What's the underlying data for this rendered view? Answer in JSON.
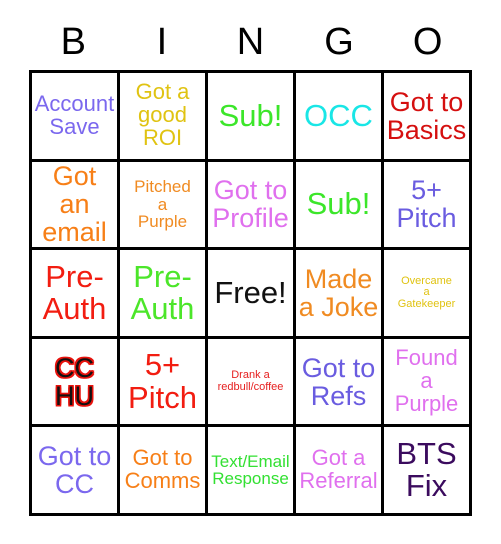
{
  "card": {
    "title": "BINGO",
    "headers": [
      "B",
      "I",
      "N",
      "G",
      "O"
    ],
    "background": "#ffffff",
    "grid_line_color": "#000000",
    "rows": [
      [
        {
          "text": "Account\nSave",
          "color": "#7b68ee",
          "size": "md"
        },
        {
          "text": "Got a\ngood\nROI",
          "color": "#e0c312",
          "size": "md"
        },
        {
          "text": "Sub!",
          "color": "#3ce62a",
          "size": "xl"
        },
        {
          "text": "OCC",
          "color": "#19e6e6",
          "size": "xl"
        },
        {
          "text": "Got to\nBasics",
          "color": "#d50f0f",
          "size": "lg"
        }
      ],
      [
        {
          "text": "Got an\nemail",
          "color": "#f77f17",
          "size": "lg"
        },
        {
          "text": "Pitched\na\nPurple",
          "color": "#f08b22",
          "size": "sm"
        },
        {
          "text": "Got to\nProfile",
          "color": "#e070ee",
          "size": "lg"
        },
        {
          "text": "Sub!",
          "color": "#3ce62a",
          "size": "xl"
        },
        {
          "text": "5+\nPitch",
          "color": "#6a5ce0",
          "size": "lg"
        }
      ],
      [
        {
          "text": "Pre-\nAuth",
          "color": "#f21d11",
          "size": "xl"
        },
        {
          "text": "Pre-\nAuth",
          "color": "#4ce62a",
          "size": "xl"
        },
        {
          "text": "Free!",
          "color": "#111111",
          "size": "xl"
        },
        {
          "text": "Made\na Joke",
          "color": "#f08b22",
          "size": "lg"
        },
        {
          "text": "Overcame\na\nGatekeeper",
          "color": "#e0c312",
          "size": "xs"
        }
      ],
      [
        {
          "text": "CC\nHU",
          "color": "#111111",
          "size": "lg",
          "style": "shadow-red"
        },
        {
          "text": "5+\nPitch",
          "color": "#f21d11",
          "size": "xl"
        },
        {
          "text": "Drank a\nredbull/coffee",
          "color": "#e62020",
          "size": "xs"
        },
        {
          "text": "Got to\nRefs",
          "color": "#6a5ce0",
          "size": "lg"
        },
        {
          "text": "Found\na\nPurple",
          "color": "#e070ee",
          "size": "md"
        }
      ],
      [
        {
          "text": "Got to\nCC",
          "color": "#7b68ee",
          "size": "lg"
        },
        {
          "text": "Got to\nComms",
          "color": "#f77f17",
          "size": "md"
        },
        {
          "text": "Text/Email\nResponse",
          "color": "#33e033",
          "size": "sm"
        },
        {
          "text": "Got a\nReferral",
          "color": "#e070ee",
          "size": "md"
        },
        {
          "text": "BTS\nFix",
          "color": "#3b0b5e",
          "size": "xl"
        }
      ]
    ]
  }
}
